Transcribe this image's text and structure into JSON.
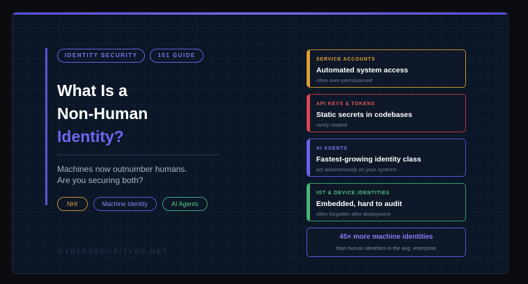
{
  "tags": [
    "IDENTITY SECURITY",
    "101 GUIDE"
  ],
  "title": {
    "line1": "What Is a",
    "line2": "Non-Human",
    "line3": "Identity?"
  },
  "subtitle": {
    "line1": "Machines now outnumber humans.",
    "line2": "Are you securing both?"
  },
  "pills": [
    "NHI",
    "Machine Identity",
    "AI Agents"
  ],
  "footer": "CYBERSECURITYOS.NET",
  "cards": [
    {
      "label": "SERVICE ACCOUNTS",
      "heading": "Automated system access",
      "desc": "often over-permissioned",
      "color": "#e3a03a"
    },
    {
      "label": "API KEYS & TOKENS",
      "heading": "Static secrets in codebases",
      "desc": "rarely rotated",
      "color": "#e2474f"
    },
    {
      "label": "AI AGENTS",
      "heading": "Fastest-growing identity class",
      "desc": "act autonomously on your systems",
      "color": "#6963ec"
    },
    {
      "label": "IOT & DEVICE IDENTITIES",
      "heading": "Embedded, hard to audit",
      "desc": "often forgotten after deployment",
      "color": "#49b979"
    }
  ],
  "stat": {
    "headline": "45× more machine identities",
    "detail": "than human identities in the avg. enterprise"
  }
}
